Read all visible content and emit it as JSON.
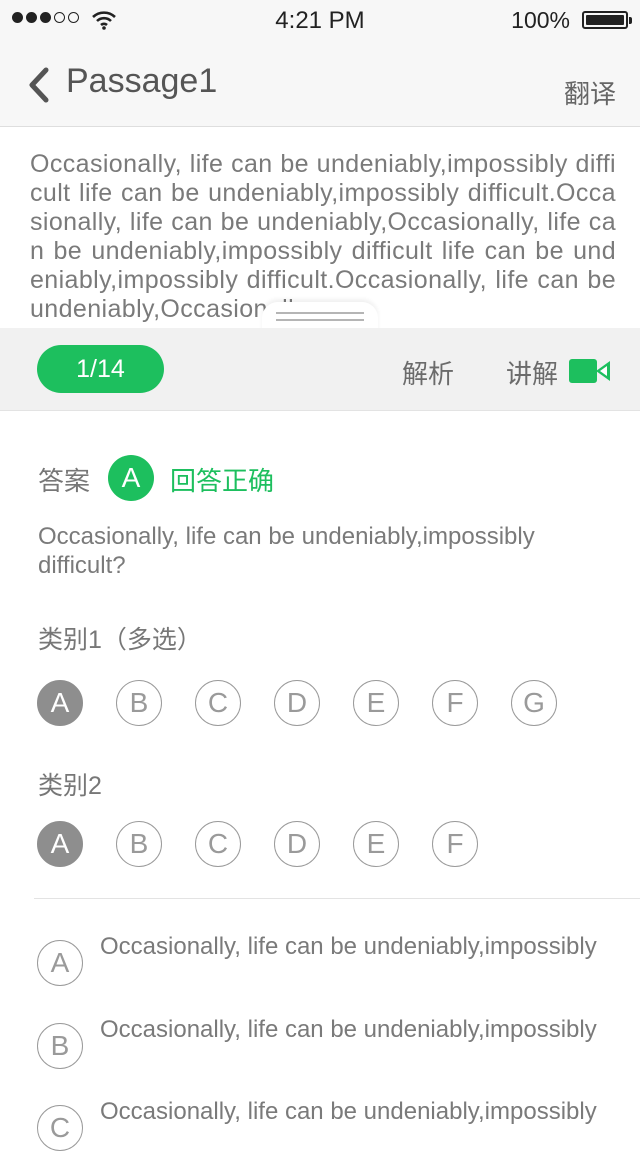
{
  "status_bar": {
    "signal_bars": 5,
    "signal_filled": 3,
    "time": "4:21 PM",
    "battery_percent": "100%"
  },
  "nav": {
    "title": "Passage1",
    "translate_label": "翻译"
  },
  "passage": {
    "text": "Occasionally, life can be undeniably,impossibly difficult life can be undeniably,impossibly difficult.Occasionally, life can be undeniably,Occasionally, life can be undeniably,impossibly difficult life can be undeniably,impossibly difficult.Occasionally, life can be undeniably,Occasionally,"
  },
  "toolbar": {
    "progress": "1/14",
    "analysis_label": "解析",
    "explain_label": "讲解",
    "video_icon": "video-camera-icon",
    "accent_color": "#1dbf5e"
  },
  "answer": {
    "label": "答案",
    "letter": "A",
    "status": "回答正确"
  },
  "question": {
    "text": "Occasionally, life can be undeniably,impossibly difficult?"
  },
  "categories": [
    {
      "label": "类别1（多选）",
      "options": [
        "A",
        "B",
        "C",
        "D",
        "E",
        "F",
        "G"
      ],
      "selected": "A"
    },
    {
      "label": "类别2",
      "options": [
        "A",
        "B",
        "C",
        "D",
        "E",
        "F"
      ],
      "selected": "A"
    }
  ],
  "choices": [
    {
      "letter": "A",
      "text": "Occasionally, life can be undeniably,impossibly"
    },
    {
      "letter": "B",
      "text": "Occasionally, life can be undeniably,impossibly"
    },
    {
      "letter": "C",
      "text": "Occasionally, life can be undeniably,impossibly"
    }
  ]
}
